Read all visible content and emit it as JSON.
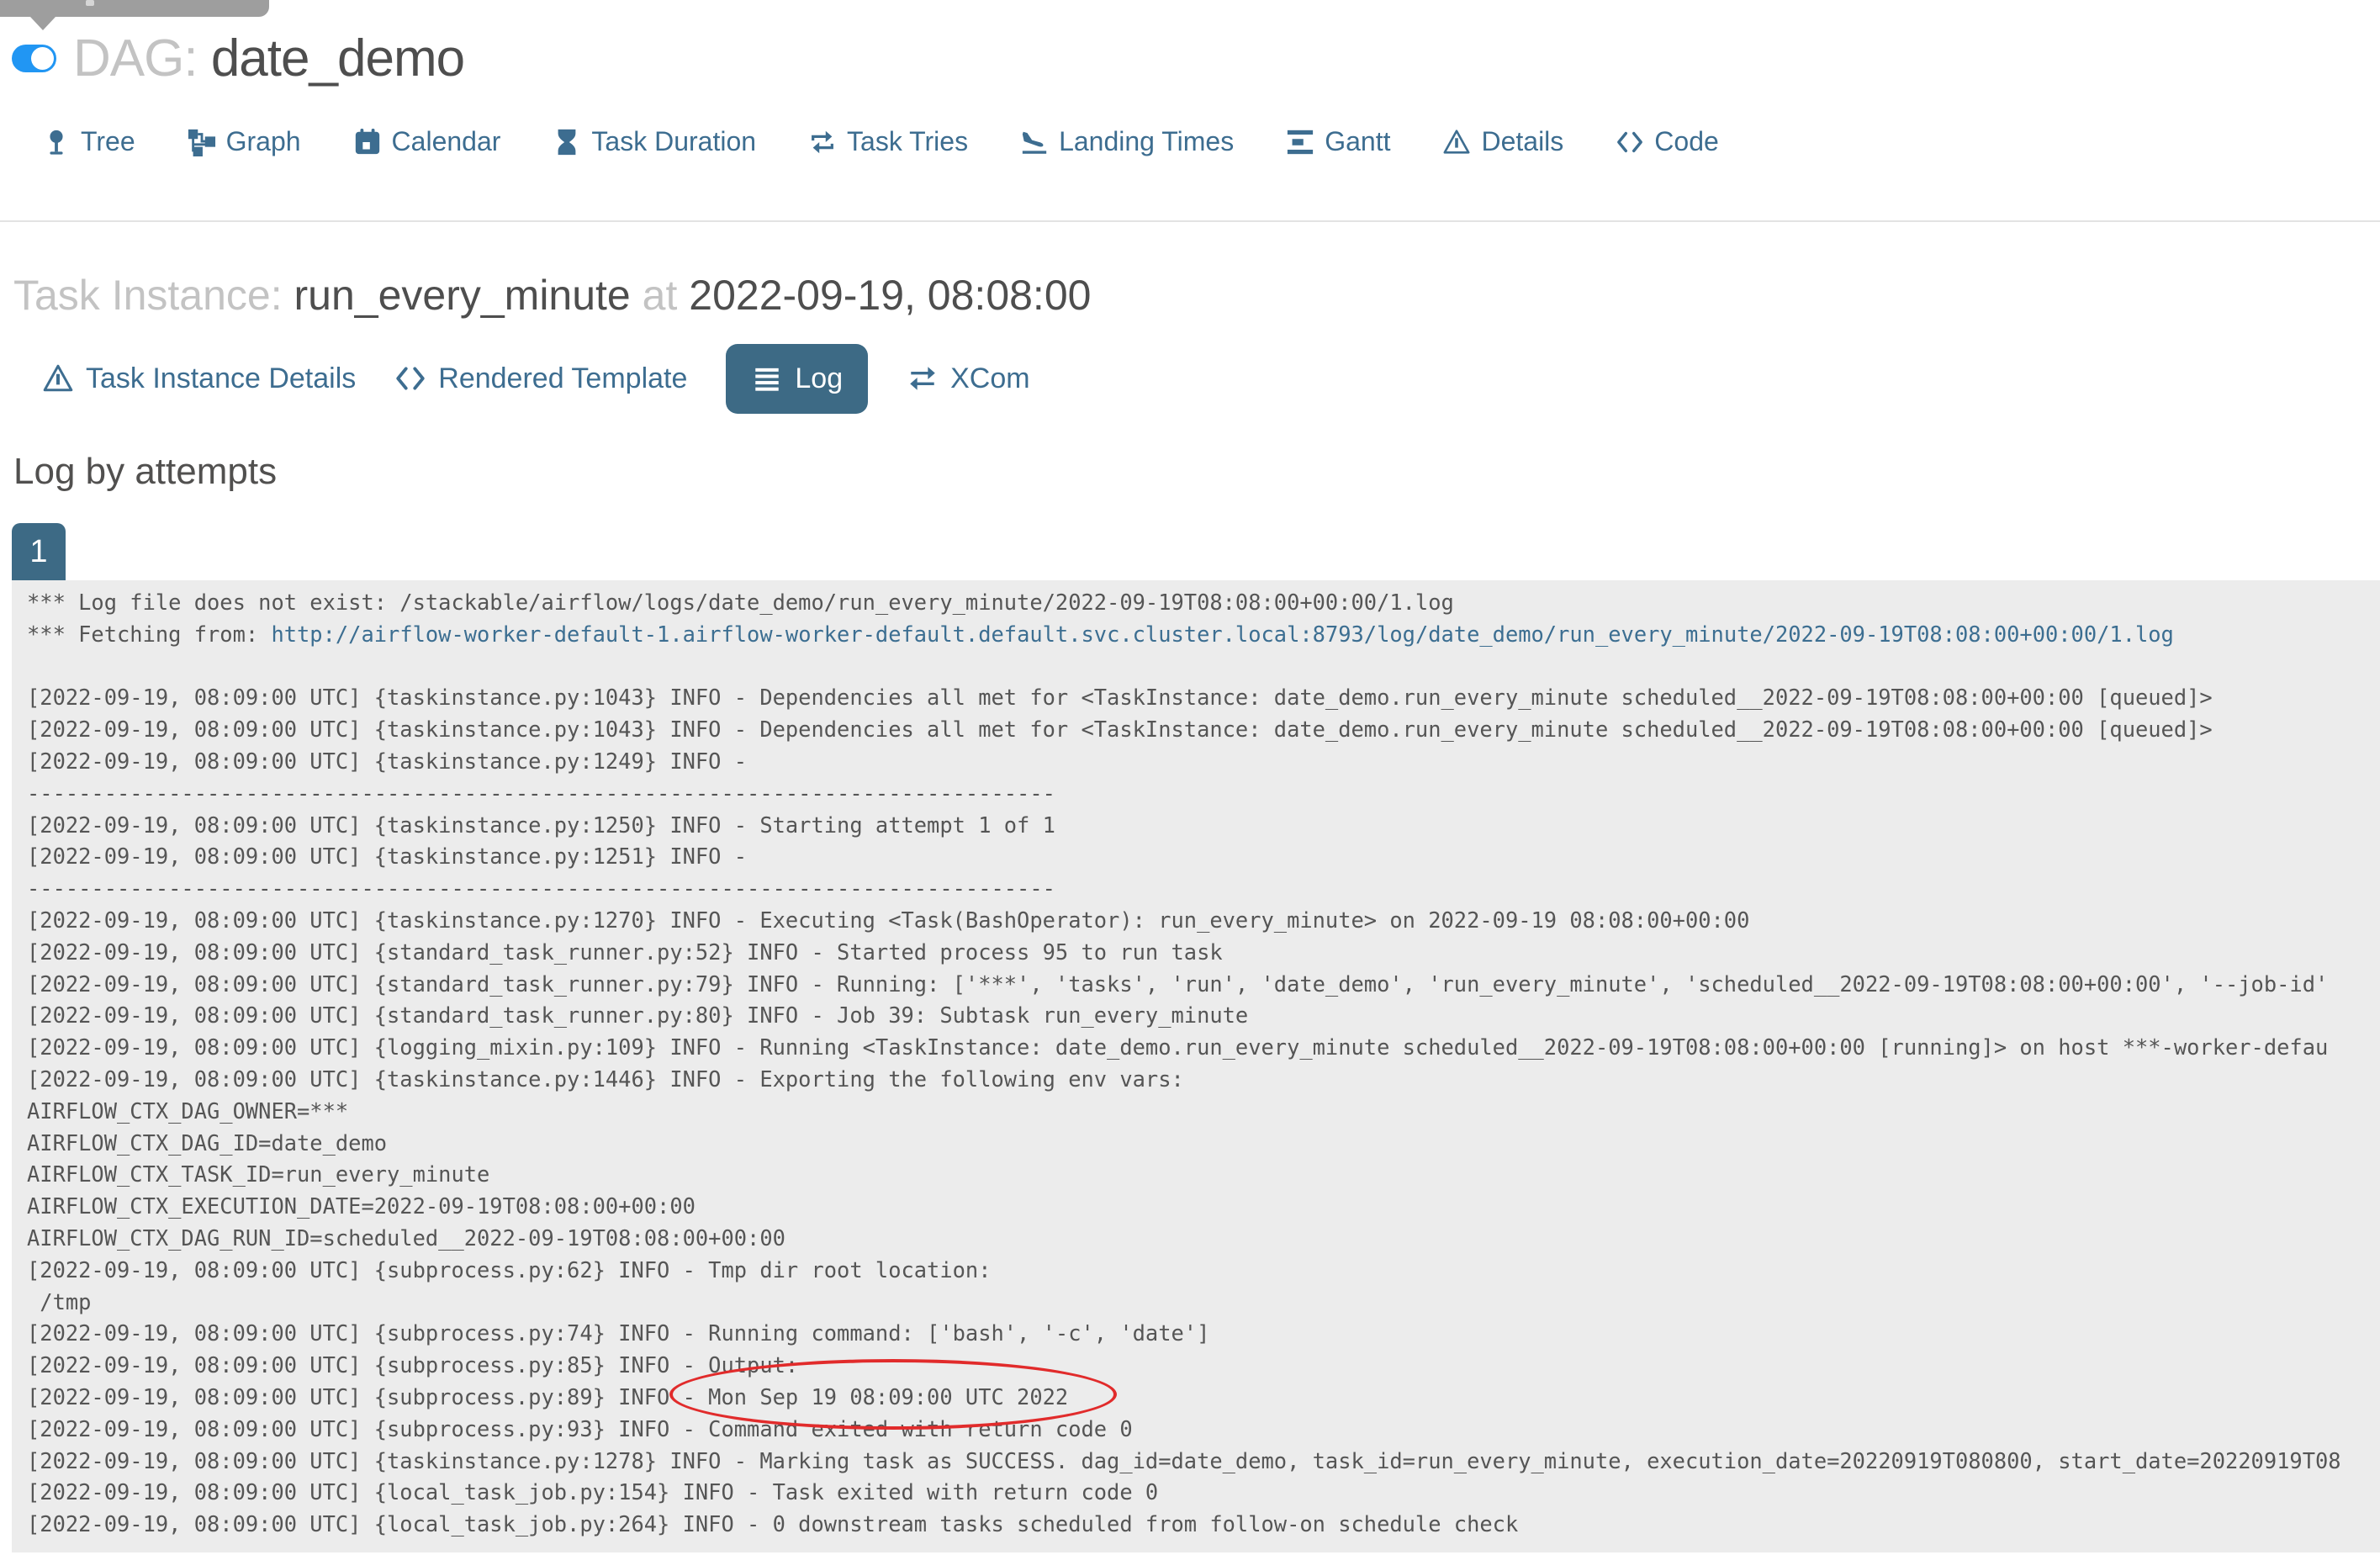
{
  "header": {
    "dag_label": "DAG:",
    "dag_name": "date_demo",
    "toggle_on": true
  },
  "nav": {
    "items": [
      {
        "label": "Tree",
        "icon": "pin-icon"
      },
      {
        "label": "Graph",
        "icon": "sitemap-icon"
      },
      {
        "label": "Calendar",
        "icon": "calendar-icon"
      },
      {
        "label": "Task Duration",
        "icon": "hourglass-icon"
      },
      {
        "label": "Task Tries",
        "icon": "repeat-icon"
      },
      {
        "label": "Landing Times",
        "icon": "plane-landing-icon"
      },
      {
        "label": "Gantt",
        "icon": "gantt-icon"
      },
      {
        "label": "Details",
        "icon": "warning-triangle-icon"
      },
      {
        "label": "Code",
        "icon": "code-icon"
      }
    ]
  },
  "task_instance": {
    "label": "Task Instance:",
    "name": "run_every_minute",
    "preposition": "at",
    "datetime": "2022-09-19, 08:08:00"
  },
  "actions": {
    "items": [
      {
        "label": "Task Instance Details",
        "icon": "warning-triangle-icon",
        "active": false
      },
      {
        "label": "Rendered Template",
        "icon": "code-icon",
        "active": false
      },
      {
        "label": "Log",
        "icon": "list-icon",
        "active": true
      },
      {
        "label": "XCom",
        "icon": "exchange-icon",
        "active": false
      }
    ]
  },
  "log_section": {
    "heading": "Log by attempts",
    "attempts": [
      "1"
    ],
    "annotation": {
      "shape": "ellipse",
      "color": "#e12b2b",
      "around_text": "Mon Sep 19 08:09:00 UTC 2022"
    },
    "lines": [
      {
        "t": "*** Log file does not exist: /stackable/airflow/logs/date_demo/run_every_minute/2022-09-19T08:08:00+00:00/1.log"
      },
      {
        "prefix": "*** Fetching from: ",
        "link": "http://airflow-worker-default-1.airflow-worker-default.default.svc.cluster.local:8793/log/date_demo/run_every_minute/2022-09-19T08:08:00+00:00/1.log"
      },
      {
        "t": ""
      },
      {
        "t": "[2022-09-19, 08:09:00 UTC] {taskinstance.py:1043} INFO - Dependencies all met for <TaskInstance: date_demo.run_every_minute scheduled__2022-09-19T08:08:00+00:00 [queued]>"
      },
      {
        "t": "[2022-09-19, 08:09:00 UTC] {taskinstance.py:1043} INFO - Dependencies all met for <TaskInstance: date_demo.run_every_minute scheduled__2022-09-19T08:08:00+00:00 [queued]>"
      },
      {
        "t": "[2022-09-19, 08:09:00 UTC] {taskinstance.py:1249} INFO - "
      },
      {
        "t": "--------------------------------------------------------------------------------"
      },
      {
        "t": "[2022-09-19, 08:09:00 UTC] {taskinstance.py:1250} INFO - Starting attempt 1 of 1"
      },
      {
        "t": "[2022-09-19, 08:09:00 UTC] {taskinstance.py:1251} INFO - "
      },
      {
        "t": "--------------------------------------------------------------------------------"
      },
      {
        "t": "[2022-09-19, 08:09:00 UTC] {taskinstance.py:1270} INFO - Executing <Task(BashOperator): run_every_minute> on 2022-09-19 08:08:00+00:00"
      },
      {
        "t": "[2022-09-19, 08:09:00 UTC] {standard_task_runner.py:52} INFO - Started process 95 to run task"
      },
      {
        "t": "[2022-09-19, 08:09:00 UTC] {standard_task_runner.py:79} INFO - Running: ['***', 'tasks', 'run', 'date_demo', 'run_every_minute', 'scheduled__2022-09-19T08:08:00+00:00', '--job-id'"
      },
      {
        "t": "[2022-09-19, 08:09:00 UTC] {standard_task_runner.py:80} INFO - Job 39: Subtask run_every_minute"
      },
      {
        "t": "[2022-09-19, 08:09:00 UTC] {logging_mixin.py:109} INFO - Running <TaskInstance: date_demo.run_every_minute scheduled__2022-09-19T08:08:00+00:00 [running]> on host ***-worker-defau"
      },
      {
        "t": "[2022-09-19, 08:09:00 UTC] {taskinstance.py:1446} INFO - Exporting the following env vars:"
      },
      {
        "t": "AIRFLOW_CTX_DAG_OWNER=***"
      },
      {
        "t": "AIRFLOW_CTX_DAG_ID=date_demo"
      },
      {
        "t": "AIRFLOW_CTX_TASK_ID=run_every_minute"
      },
      {
        "t": "AIRFLOW_CTX_EXECUTION_DATE=2022-09-19T08:08:00+00:00"
      },
      {
        "t": "AIRFLOW_CTX_DAG_RUN_ID=scheduled__2022-09-19T08:08:00+00:00"
      },
      {
        "t": "[2022-09-19, 08:09:00 UTC] {subprocess.py:62} INFO - Tmp dir root location:"
      },
      {
        "t": " /tmp"
      },
      {
        "t": "[2022-09-19, 08:09:00 UTC] {subprocess.py:74} INFO - Running command: ['bash', '-c', 'date']"
      },
      {
        "t": "[2022-09-19, 08:09:00 UTC] {subprocess.py:85} INFO - Output:"
      },
      {
        "t": "[2022-09-19, 08:09:00 UTC] {subprocess.py:89} INFO - Mon Sep 19 08:09:00 UTC 2022"
      },
      {
        "t": "[2022-09-19, 08:09:00 UTC] {subprocess.py:93} INFO - Command exited with return code 0"
      },
      {
        "t": "[2022-09-19, 08:09:00 UTC] {taskinstance.py:1278} INFO - Marking task as SUCCESS. dag_id=date_demo, task_id=run_every_minute, execution_date=20220919T080800, start_date=20220919T08"
      },
      {
        "t": "[2022-09-19, 08:09:00 UTC] {local_task_job.py:154} INFO - Task exited with return code 0"
      },
      {
        "t": "[2022-09-19, 08:09:00 UTC] {local_task_job.py:264} INFO - 0 downstream tasks scheduled from follow-on schedule check"
      }
    ]
  },
  "colors": {
    "accent_blue": "#3d6d90",
    "button_blue": "#3d6a85",
    "toggle_blue": "#2196f3",
    "link_blue": "#3c6e91",
    "log_background": "#ececec",
    "annotation_red": "#e12b2b",
    "muted_gray": "#c3c3c3",
    "text_dark": "#51504f"
  }
}
